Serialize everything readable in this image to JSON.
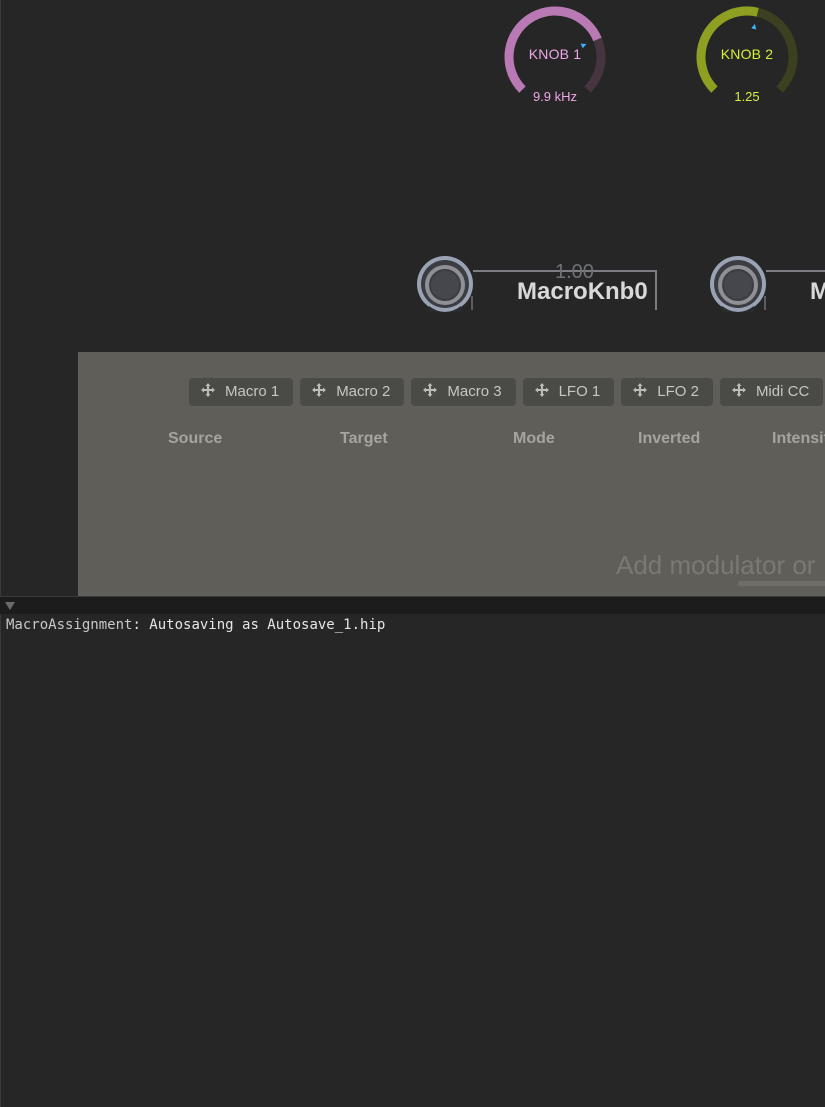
{
  "knobs": [
    {
      "label": "KNOB 1",
      "value": "9.9 kHz",
      "level": 0.75,
      "color": "#b979b4",
      "track": "#46343f",
      "pointer": "#3fb2ff"
    },
    {
      "label": "KNOB 2",
      "value": "1.25",
      "level": 0.55,
      "color": "#8e9f22",
      "track": "#3c4020",
      "pointer": "#3fb2ff"
    }
  ],
  "macros": [
    {
      "value": "1.00",
      "name": "MacroKnb0"
    },
    {
      "value": "",
      "name": "M"
    }
  ],
  "mod_panel": {
    "sources": [
      "Macro 1",
      "Macro 2",
      "Macro 3",
      "LFO 1",
      "LFO 2",
      "Midi CC",
      ""
    ],
    "columns": [
      "Source",
      "Target",
      "Mode",
      "Inverted",
      "Intensity"
    ],
    "hint": "Add modulator or"
  },
  "console": {
    "source": "MacroAssignment",
    "message": ": Autosaving as Autosave_1.hip"
  }
}
